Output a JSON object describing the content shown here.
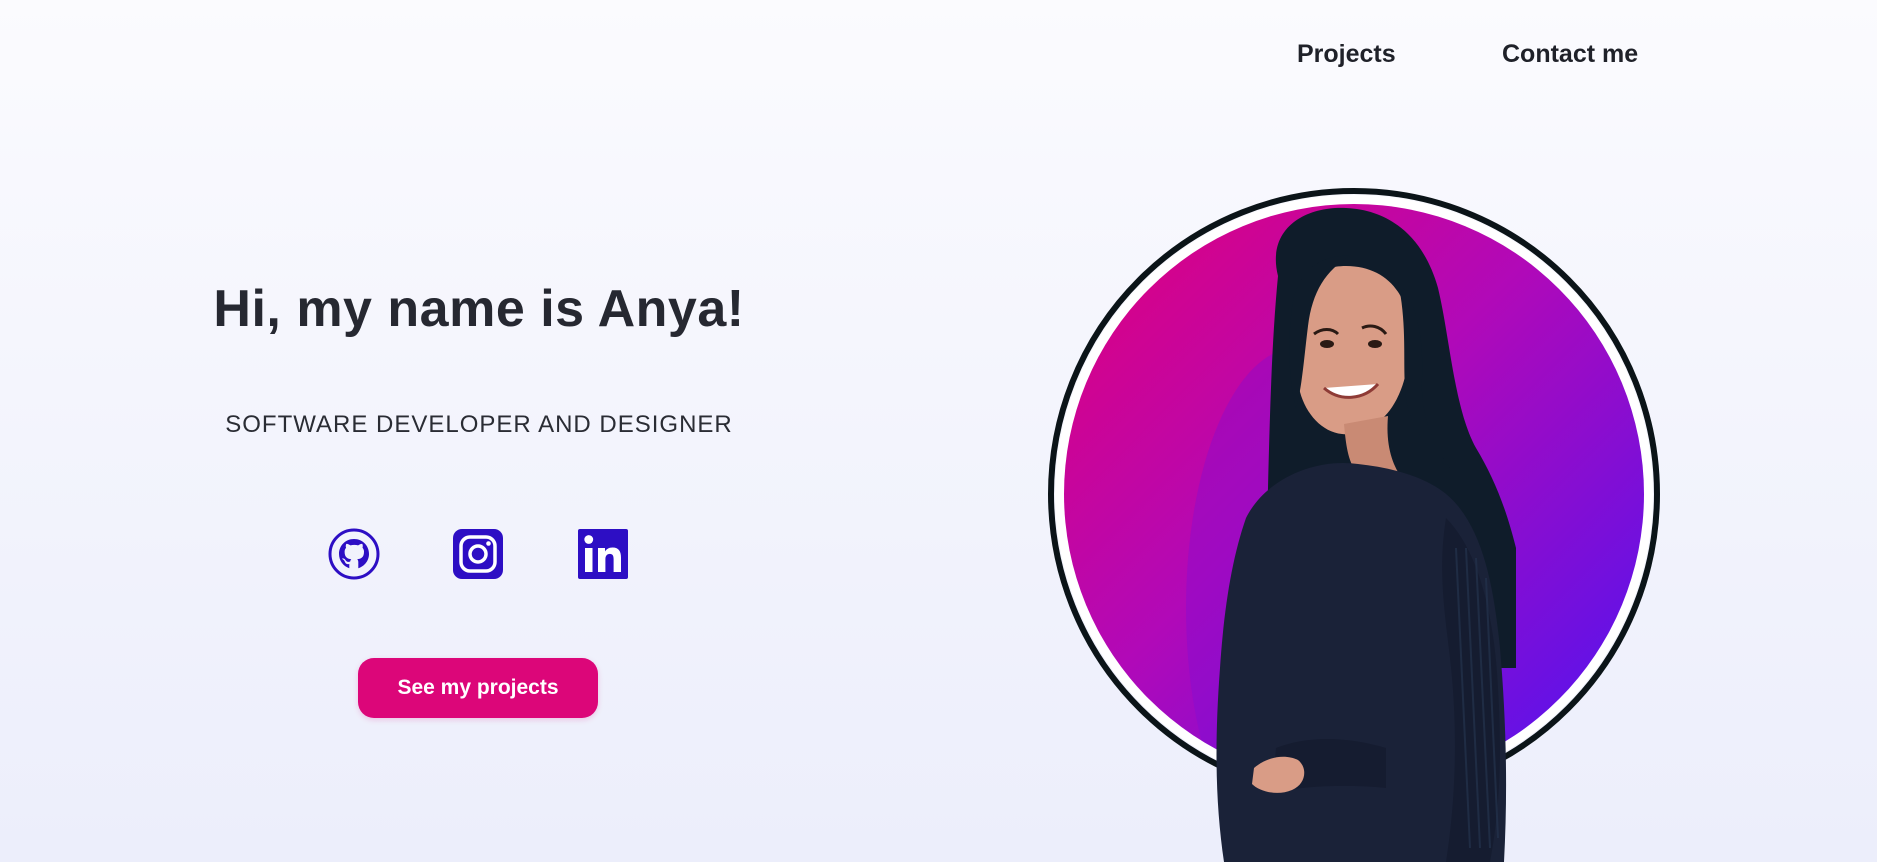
{
  "nav": {
    "items": [
      {
        "label": "Projects"
      },
      {
        "label": "Contact me"
      }
    ]
  },
  "hero": {
    "title": "Hi, my name is Anya!",
    "subtitle": "SOFTWARE DEVELOPER AND DESIGNER",
    "cta_label": "See my projects"
  },
  "social": [
    {
      "name": "GitHub",
      "icon": "github-icon"
    },
    {
      "name": "Instagram",
      "icon": "instagram-icon"
    },
    {
      "name": "LinkedIn",
      "icon": "linkedin-icon"
    }
  ],
  "colors": {
    "accent": "#dc0679",
    "icon": "#2d0ec4",
    "circle_gradient_start": "#e2007a",
    "circle_gradient_end": "#4b14f5",
    "ring": "#0b1418"
  }
}
